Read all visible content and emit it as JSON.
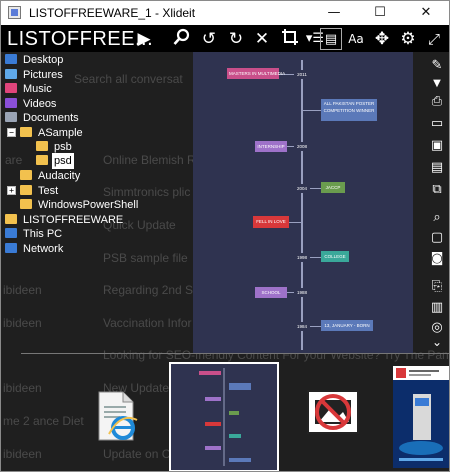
{
  "window": {
    "title": "LISTOFFREEWARE_1 - Xlideit",
    "minimize": "—",
    "maximize": "☐",
    "close": "✕"
  },
  "toolbar": {
    "app_title": "LISTOFFREE...",
    "icons": [
      "play-icon",
      "zoom-icon",
      "rotate-left-icon",
      "rotate-right-icon",
      "close-icon",
      "crop-icon",
      "menu-icon",
      "document-icon",
      "text-size-icon",
      "move-icon",
      "settings-icon",
      "fullscreen-icon"
    ]
  },
  "background_ghost_text": [
    "Search all conversat",
    "are",
    "Online Blemish Re",
    "Simmtronics plic",
    "Quick Update",
    "PSB sample file",
    "ibideen",
    "Regarding 2nd Sa",
    "ibideen",
    "Vaccination Infor",
    "Looking for SEO-friendly Content For your Website? Try The Pandit",
    "New Update Re             cation Leave",
    "ibideen",
    "me 2                   ance Diet",
    "ibideen",
    "Update on CoV"
  ],
  "tree": [
    {
      "label": "Desktop",
      "icon": "desktop-icon",
      "color": "#3a7bd5"
    },
    {
      "label": "Pictures",
      "icon": "pictures-icon",
      "color": "#5fa8e8"
    },
    {
      "label": "Music",
      "icon": "music-icon",
      "color": "#e0457b"
    },
    {
      "label": "Videos",
      "icon": "videos-icon",
      "color": "#8a4fd8"
    },
    {
      "label": "Documents",
      "icon": "documents-icon",
      "color": "#9aa4b5"
    },
    {
      "label": "ASample",
      "icon": "folder-icon",
      "color": "#f2c14e"
    },
    {
      "label": "psb",
      "icon": "folder-icon",
      "color": "#f2c14e"
    },
    {
      "label": "psd",
      "icon": "folder-icon",
      "color": "#f2c14e"
    },
    {
      "label": "Audacity",
      "icon": "folder-icon",
      "color": "#f2c14e"
    },
    {
      "label": "Test",
      "icon": "folder-icon",
      "color": "#f2c14e"
    },
    {
      "label": "WindowsPowerShell",
      "icon": "folder-icon",
      "color": "#f2c14e"
    },
    {
      "label": "LISTOFFREEWARE",
      "icon": "folder-icon",
      "color": "#f2c14e"
    },
    {
      "label": "This PC",
      "icon": "computer-icon",
      "color": "#3a7bd5"
    },
    {
      "label": "Network",
      "icon": "network-icon",
      "color": "#3a7bd5"
    }
  ],
  "timeline": {
    "events": [
      {
        "label": "MASTERS IN MULTIMEDIA",
        "year": "2011",
        "side": "left",
        "color": "#c94f8a"
      },
      {
        "label": "ALL PAKISTAN POSTER COMPETITION WINNER",
        "year": "",
        "side": "right",
        "color": "#5b79b9"
      },
      {
        "label": "INTERNSHIP",
        "year": "2008",
        "side": "left",
        "color": "#9e72c9"
      },
      {
        "label": "JACCP",
        "year": "2004",
        "side": "right",
        "color": "#6a9c4e"
      },
      {
        "label": "FELL IN LOVE",
        "year": "",
        "side": "left",
        "color": "#d8383a"
      },
      {
        "label": "COLLEGE",
        "year": "1998",
        "side": "right",
        "color": "#3aa89a"
      },
      {
        "label": "SCHOOL",
        "year": "1988",
        "side": "left",
        "color": "#9e72c9"
      },
      {
        "label": "13, JANUARY - BORN",
        "year": "1984",
        "side": "right",
        "color": "#5b79b9"
      }
    ]
  },
  "right_toolbar": [
    "edit-icon",
    "dropdown-icon",
    "print-icon",
    "laptop-icon",
    "image-icon",
    "slideshow-icon",
    "gallery-icon",
    "search-page-icon",
    "window-icon",
    "camera-icon",
    "copy-icon",
    "clipboard-icon",
    "target-icon",
    "chevron-down-icon"
  ],
  "thumbnails": [
    "ie-document-thumbnail",
    "timeline-thumbnail",
    "no-image-thumbnail",
    "product-thumbnail"
  ]
}
